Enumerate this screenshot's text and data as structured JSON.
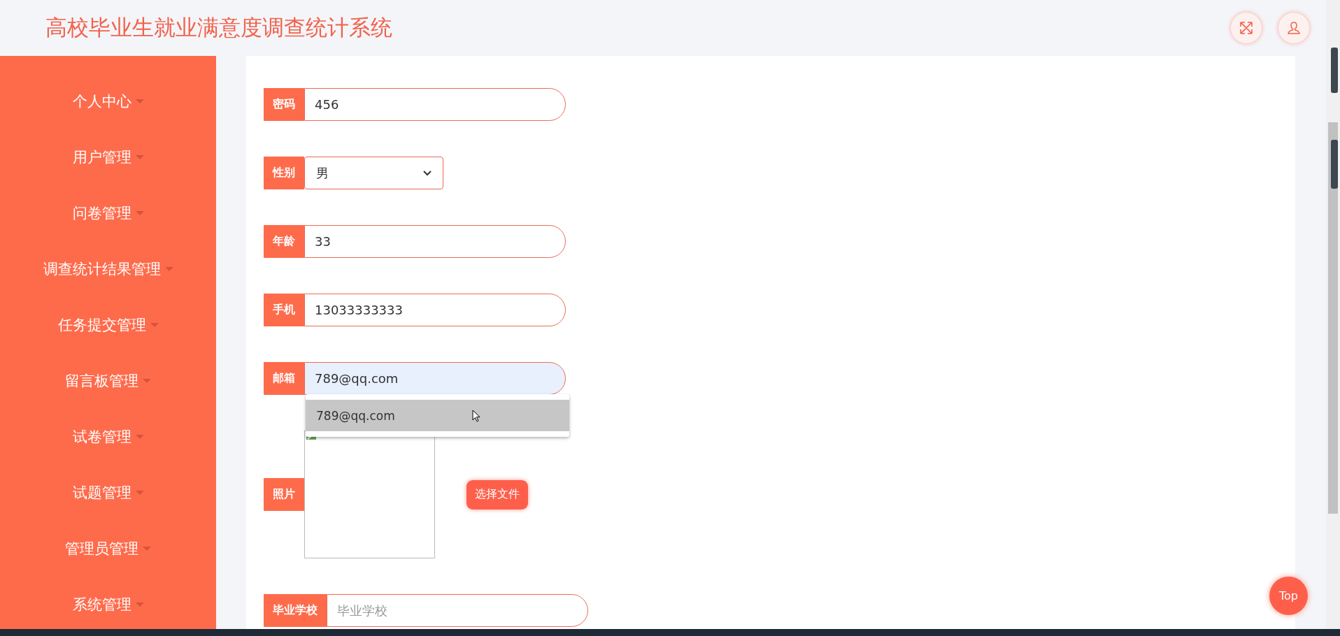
{
  "header": {
    "title": "高校毕业生就业满意度调查统计系统"
  },
  "sidebar": {
    "items": [
      {
        "label": "个人中心"
      },
      {
        "label": "用户管理"
      },
      {
        "label": "问卷管理"
      },
      {
        "label": "调查统计结果管理"
      },
      {
        "label": "任务提交管理"
      },
      {
        "label": "留言板管理"
      },
      {
        "label": "试卷管理"
      },
      {
        "label": "试题管理"
      },
      {
        "label": "管理员管理"
      },
      {
        "label": "系统管理"
      }
    ]
  },
  "form": {
    "fields": [
      {
        "kind": "text",
        "label": "密码",
        "value": "456"
      },
      {
        "kind": "select",
        "label": "性别",
        "value": "男"
      },
      {
        "kind": "text",
        "label": "年龄",
        "value": "33"
      },
      {
        "kind": "text",
        "label": "手机",
        "value": "13033333333"
      },
      {
        "kind": "text",
        "label": "邮箱",
        "value": "789@qq.com",
        "autofilled": true,
        "suggestions": [
          {
            "text": "789@qq.com",
            "selected": true
          }
        ]
      },
      {
        "kind": "photo",
        "label": "照片",
        "button": "选择文件"
      },
      {
        "kind": "text",
        "label": "毕业学校",
        "placeholder": "毕业学校"
      }
    ]
  },
  "top_button": {
    "label": "Top"
  }
}
